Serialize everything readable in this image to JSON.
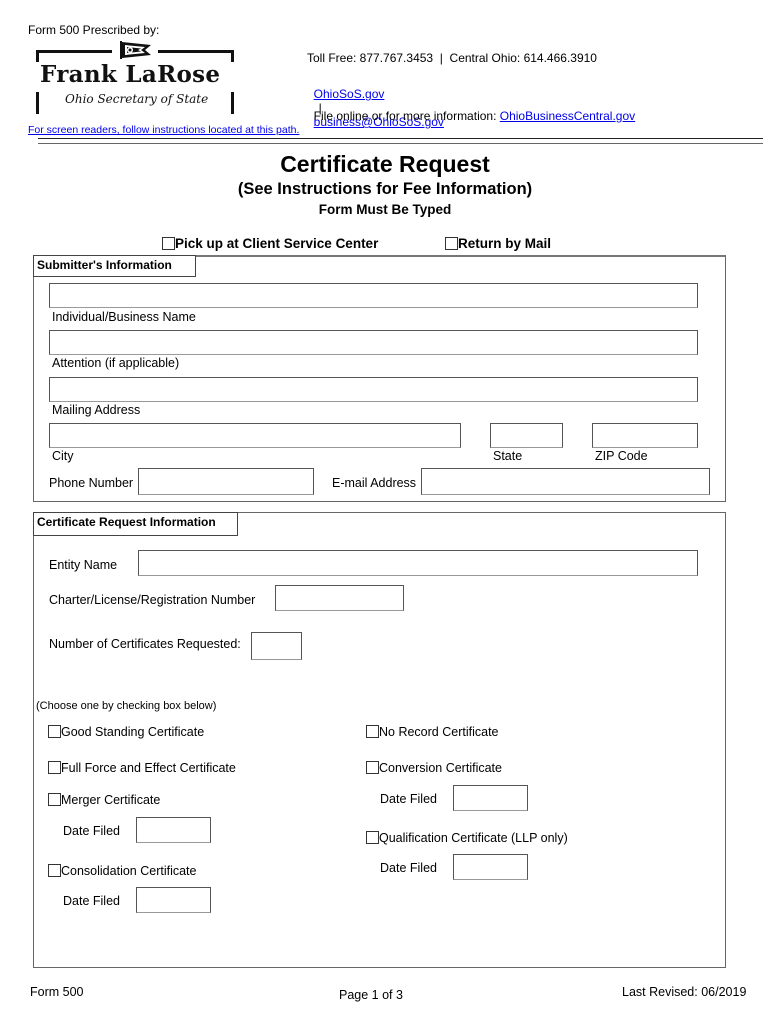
{
  "header": {
    "prescribed_by": "Form 500 Prescribed by:",
    "logo": {
      "name": "Frank LaRose",
      "subtitle": "Ohio Secretary of State",
      "icon": "ohio-flag-icon"
    },
    "contact": {
      "toll_free_line": "Toll Free: 877.767.3453  |  Central Ohio: 614.466.3910",
      "website_link": "OhioSoS.gov",
      "separator": "|",
      "email_link": "business@OhioSoS.gov",
      "file_online_text": "File online or for more information: ",
      "file_online_link": "OhioBusinessCentral.gov"
    },
    "screen_reader_link": "For screen readers, follow instructions located at this path."
  },
  "title": {
    "main": "Certificate Request",
    "subtitle": "(See Instructions for Fee Information)",
    "note": "Form Must Be Typed"
  },
  "delivery_options": [
    {
      "label": "Pick up at Client Service Center",
      "checked": false
    },
    {
      "label": "Return by Mail",
      "checked": false
    }
  ],
  "submitter": {
    "section_title": "Submitter's Information",
    "fields": {
      "name": {
        "label": "Individual/Business Name",
        "value": ""
      },
      "attention": {
        "label": "Attention (if applicable)",
        "value": ""
      },
      "address": {
        "label": "Mailing Address",
        "value": ""
      },
      "city": {
        "label": "City",
        "value": ""
      },
      "state": {
        "label": "State",
        "value": ""
      },
      "zip": {
        "label": "ZIP Code",
        "value": ""
      },
      "phone": {
        "label": "Phone Number",
        "value": ""
      },
      "email": {
        "label": "E-mail Address",
        "value": ""
      }
    }
  },
  "certificate": {
    "section_title": "Certificate Request Information",
    "entity_name": {
      "label": "Entity Name",
      "value": ""
    },
    "charter_number": {
      "label": "Charter/License/Registration Number",
      "value": ""
    },
    "num_certificates": {
      "label": "Number of Certificates Requested:",
      "value": ""
    },
    "choose_instruction": "(Choose one by checking box below)",
    "options": {
      "good_standing": {
        "label": "Good Standing Certificate",
        "checked": false
      },
      "no_record": {
        "label": "No Record Certificate",
        "checked": false
      },
      "full_force": {
        "label": "Full Force and Effect Certificate",
        "checked": false
      },
      "conversion": {
        "label": "Conversion Certificate",
        "checked": false
      },
      "merger": {
        "label": "Merger Certificate",
        "checked": false
      },
      "qualification": {
        "label": "Qualification Certificate (LLP only)",
        "checked": false
      },
      "consolidation": {
        "label": "Consolidation Certificate",
        "checked": false
      }
    },
    "date_filed_label": "Date Filed",
    "date_filed": {
      "conversion": "",
      "merger": "",
      "qualification": "",
      "consolidation": ""
    }
  },
  "footer": {
    "form_number": "Form 500",
    "page": "Page 1 of 3",
    "revised": "Last Revised: 06/2019"
  }
}
